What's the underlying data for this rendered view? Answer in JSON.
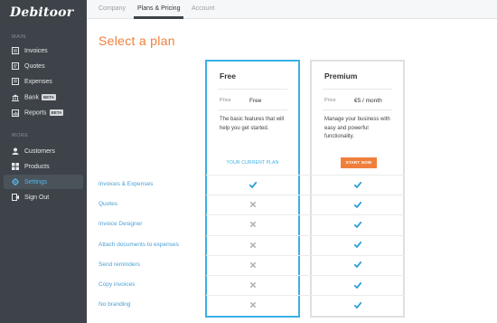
{
  "app": {
    "logo": "Debitoor"
  },
  "sidebar": {
    "main_label": "MAIN",
    "more_label": "MORE",
    "main_items": [
      {
        "label": "Invoices",
        "icon": "invoice-icon"
      },
      {
        "label": "Quotes",
        "icon": "quote-icon"
      },
      {
        "label": "Expenses",
        "icon": "expense-icon"
      },
      {
        "label": "Bank",
        "icon": "bank-icon",
        "badge": "BETA"
      },
      {
        "label": "Reports",
        "icon": "report-icon",
        "badge": "BETA"
      }
    ],
    "more_items": [
      {
        "label": "Customers",
        "icon": "customers-icon"
      },
      {
        "label": "Products",
        "icon": "products-icon"
      },
      {
        "label": "Settings",
        "icon": "gear-icon",
        "active": true
      },
      {
        "label": "Sign Out",
        "icon": "sign-out-icon"
      }
    ]
  },
  "tabs": [
    {
      "label": "Company"
    },
    {
      "label": "Plans & Pricing",
      "active": true
    },
    {
      "label": "Account"
    }
  ],
  "page": {
    "title": "Select a plan"
  },
  "plans": [
    {
      "name": "Free",
      "price_label": "Price",
      "price": "Free",
      "description": "The basic features that will help you get started.",
      "action": "YOUR CURRENT PLAN"
    },
    {
      "name": "Premium",
      "price_label": "Price",
      "price": "€5 / month",
      "description": "Manage your business with easy and powerful functionality.",
      "action": "START NOW"
    }
  ],
  "features": [
    {
      "name": "Invoices & Expenses",
      "free": true,
      "premium": true
    },
    {
      "name": "Quotes",
      "free": false,
      "premium": true
    },
    {
      "name": "Invoice Designer",
      "free": false,
      "premium": true
    },
    {
      "name": "Attach documents to expenses",
      "free": false,
      "premium": true
    },
    {
      "name": "Send reminders",
      "free": false,
      "premium": true
    },
    {
      "name": "Copy invoices",
      "free": false,
      "premium": true
    },
    {
      "name": "No branding",
      "free": false,
      "premium": true
    }
  ],
  "colors": {
    "accent": "#f07f3c",
    "link": "#4a9fd3",
    "check": "#2a9fd8",
    "cross": "#b0b4b7",
    "sidebar": "#3d4348"
  }
}
